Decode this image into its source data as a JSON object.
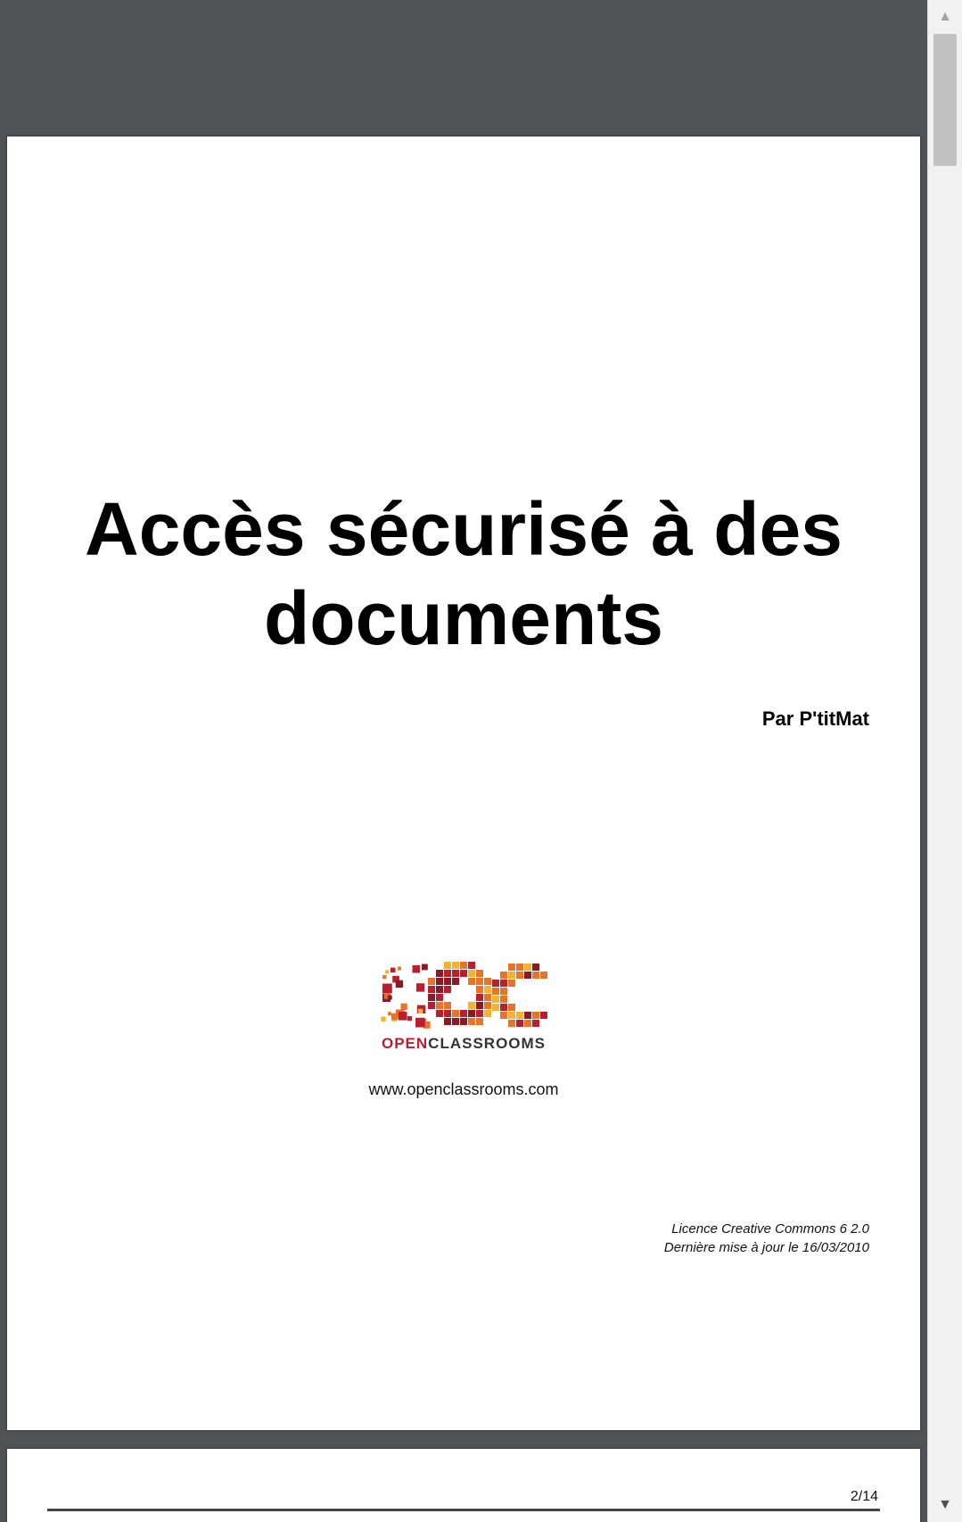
{
  "document": {
    "title": "Accès sécurisé à des documents",
    "author": "Par P'titMat",
    "logo": {
      "word_open": "OPEN",
      "word_classrooms": "CLASSROOMS",
      "mark_letters": "OC",
      "colors": {
        "red": "#b8202f",
        "orange": "#e8742a",
        "yellow": "#f2b233",
        "dark_red": "#8c1a24"
      }
    },
    "website": "www.openclassrooms.com",
    "license_line": "Licence Creative Commons 6 2.0",
    "updated_line": "Dernière mise à jour le 16/03/2010"
  },
  "next_page": {
    "page_number": "2/14"
  },
  "scrollbar": {
    "up_icon": "triangle-up",
    "down_icon": "triangle-down"
  }
}
